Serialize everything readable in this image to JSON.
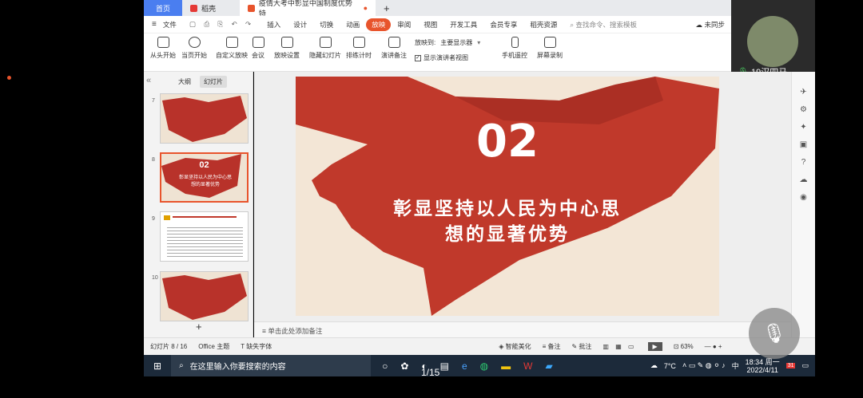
{
  "tabs": [
    {
      "label": "首页"
    },
    {
      "label": "稻壳"
    },
    {
      "label": "疫情大考中彰显中国制度优势 特"
    }
  ],
  "menu": {
    "file": "文件",
    "items": [
      "插入",
      "设计",
      "切换",
      "动画",
      "放映",
      "审阅",
      "视图",
      "开发工具",
      "会员专享",
      "稻壳资源"
    ],
    "search": "查找命令、搜索模板",
    "sync": "未同步"
  },
  "toolbar": {
    "b1": "从头开始",
    "b2": "当页开始",
    "b3": "自定义放映",
    "b4": "会议",
    "b5": "放映设置",
    "b6": "隐藏幻灯片",
    "b7": "排练计时",
    "b8": "演讲备注",
    "screen_label": "放映到:",
    "screen_value": "主要显示器",
    "presenter": "显示演讲者视图",
    "b9": "手机遥控",
    "b10": "屏幕录制"
  },
  "panel": {
    "outline": "大纲",
    "slides": "幻灯片"
  },
  "thumbs": [
    {
      "num": "7"
    },
    {
      "num": "8",
      "big": "02",
      "text": "彰显坚持以人民为中心思想的显著优势"
    },
    {
      "num": "9"
    },
    {
      "num": "10"
    }
  ],
  "slide": {
    "big": "02",
    "line1": "彰显坚持以人民为中心思",
    "line2": "想的显著优势"
  },
  "notes": "单击此处添加备注",
  "status": {
    "slide": "幻灯片 8 / 16",
    "theme": "Office 主题",
    "font": "缺失字体",
    "beautify": "智能美化",
    "notes": "备注",
    "comment": "批注",
    "zoom": "63%"
  },
  "video": {
    "user": "19汉四马…"
  },
  "taskbar": {
    "search": "在这里输入你要搜索的内容",
    "temp": "7°C",
    "lang": "中",
    "time": "18:34 周一",
    "date": "2022/4/11",
    "badge": "31"
  },
  "page_counter": "1/15",
  "colors": {
    "accent": "#e8542c",
    "slide_red": "#c0392b"
  }
}
